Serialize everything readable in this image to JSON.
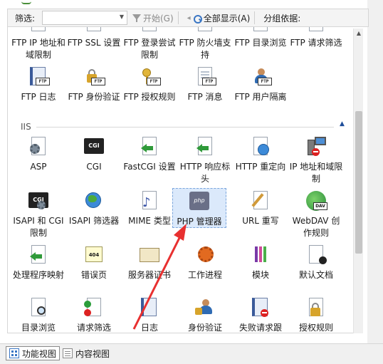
{
  "toolbar": {
    "filter_label": "筛选:",
    "start_label": "开始(G)",
    "showall_label": "全部显示(A)",
    "groupby_label": "分组依据:"
  },
  "ftp_partial_row": [
    {
      "label": "FTP IP 地址和域限制"
    },
    {
      "label": "FTP SSL 设置"
    },
    {
      "label": "FTP 登录尝试限制"
    },
    {
      "label": "FTP 防火墙支持"
    },
    {
      "label": "FTP 目录浏览"
    },
    {
      "label": "FTP 请求筛选"
    }
  ],
  "ftp_row": [
    {
      "label": "FTP 日志",
      "icon": "ftp-log-icon"
    },
    {
      "label": "FTP 身份验证",
      "icon": "ftp-auth-icon"
    },
    {
      "label": "FTP 授权规则",
      "icon": "ftp-authz-icon"
    },
    {
      "label": "FTP 消息",
      "icon": "ftp-message-icon"
    },
    {
      "label": "FTP 用户隔离",
      "icon": "ftp-user-isolation-icon"
    }
  ],
  "iis_group": {
    "title": "IIS",
    "collapse_glyph": "▲"
  },
  "iis_row1": [
    {
      "label": "ASP"
    },
    {
      "label": "CGI",
      "box_text": "CGI"
    },
    {
      "label": "FastCGI 设置"
    },
    {
      "label": "HTTP 响应标头"
    },
    {
      "label": "HTTP 重定向"
    },
    {
      "label": "IP 地址和域限制"
    }
  ],
  "iis_row2": [
    {
      "label": "ISAPI 和 CGI 限制",
      "box_text": "CGI"
    },
    {
      "label": "ISAPI 筛选器"
    },
    {
      "label": "MIME 类型"
    },
    {
      "label": "PHP 管理器",
      "box_text": "php"
    },
    {
      "label": "URL 重写"
    },
    {
      "label": "WebDAV 创作规则",
      "box_text": "DAV"
    }
  ],
  "iis_row3": [
    {
      "label": "处理程序映射"
    },
    {
      "label": "错误页",
      "box_text": "404"
    },
    {
      "label": "服务器证书"
    },
    {
      "label": "工作进程"
    },
    {
      "label": "模块"
    },
    {
      "label": "默认文档"
    }
  ],
  "iis_row4": [
    {
      "label": "目录浏览"
    },
    {
      "label": "请求筛选"
    },
    {
      "label": "日志"
    },
    {
      "label": "身份验证"
    },
    {
      "label": "失败请求跟"
    },
    {
      "label": "授权规则"
    }
  ],
  "ftp_tag": "FTP",
  "bottom_tabs": {
    "features_view": "功能视图",
    "content_view": "内容视图"
  },
  "colors": {
    "selection": "#dbe9fb",
    "annotation_arrow": "#e83030",
    "accent": "#3a76c4"
  }
}
